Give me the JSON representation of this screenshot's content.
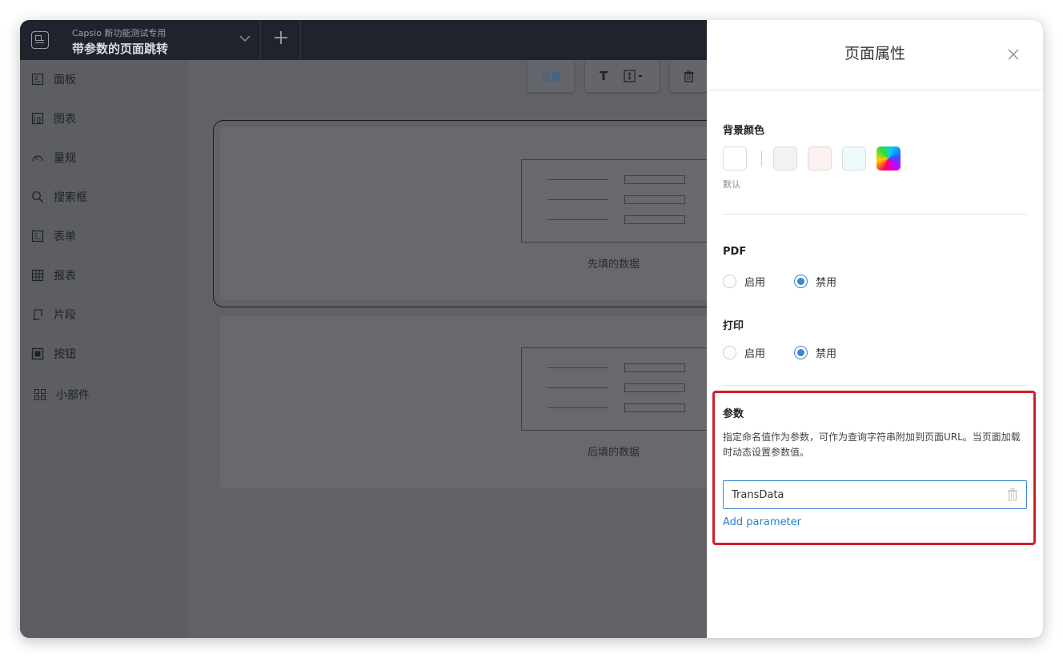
{
  "topbar": {
    "subtitle": "Capsio 新功能测试专用",
    "title": "带参数的页面跳转"
  },
  "sidebar": {
    "items": [
      {
        "label": "面板",
        "icon": "panel-icon"
      },
      {
        "label": "图表",
        "icon": "chart-icon"
      },
      {
        "label": "量规",
        "icon": "gauge-icon"
      },
      {
        "label": "搜索框",
        "icon": "search-icon"
      },
      {
        "label": "表单",
        "icon": "form-icon"
      },
      {
        "label": "报表",
        "icon": "grid-icon"
      },
      {
        "label": "片段",
        "icon": "snippet-icon"
      },
      {
        "label": "按钮",
        "icon": "button-icon"
      },
      {
        "label": "小部件",
        "icon": "widget-icon"
      }
    ]
  },
  "toolbar": {
    "settings_label": "设置",
    "text_label": "T"
  },
  "cards": [
    {
      "caption": "先填的数据"
    },
    {
      "caption": "后填的数据"
    }
  ],
  "panel": {
    "title": "页面属性",
    "bg_color": {
      "title": "背景颜色",
      "default_label": "默认",
      "swatches": [
        "#ffffff",
        "#f2f2f2",
        "#fdf1f1",
        "#edfbfb"
      ]
    },
    "pdf": {
      "title": "PDF",
      "enable": "启用",
      "disable": "禁用",
      "selected": "禁用"
    },
    "print": {
      "title": "打印",
      "enable": "启用",
      "disable": "禁用",
      "selected": "禁用"
    },
    "params": {
      "title": "参数",
      "description": "指定命名值作为参数，可作为查询字符串附加到页面URL。当页面加载时动态设置参数值。",
      "value": "TransData",
      "add_label": "Add parameter"
    }
  },
  "colors": {
    "accent": "#3b86d6",
    "highlight": "#d0202a",
    "link": "#2a7fd4"
  }
}
